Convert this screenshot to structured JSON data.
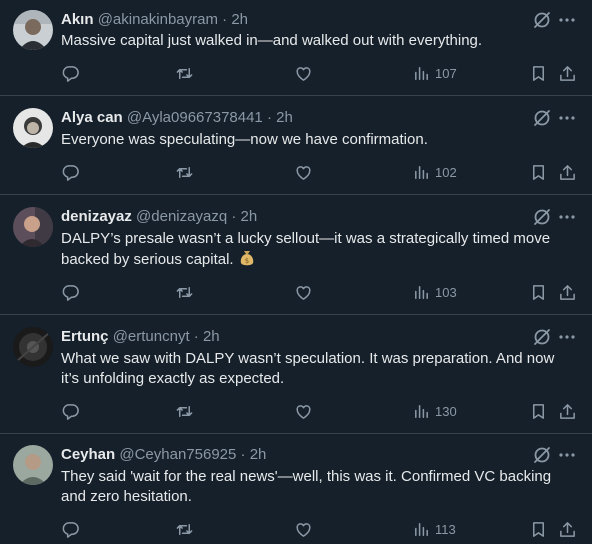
{
  "tweets": [
    {
      "name": "Akın",
      "handle": "@akinakinbayram",
      "time": "2h",
      "text": "Massive capital just walked in—and walked out with everything.",
      "views": "107",
      "avatar_color": "#cfd4d8"
    },
    {
      "name": "Alya can",
      "handle": "@Ayla09667378441",
      "time": "2h",
      "text": "Everyone was speculating—now we have confirmation.",
      "views": "102",
      "avatar_color": "#dadada"
    },
    {
      "name": "denizayaz",
      "handle": "@denizayazq",
      "time": "2h",
      "text": "DALPY’s presale wasn’t a lucky sellout—it was a strategically timed move backed by serious capital.",
      "emoji": "money-bag",
      "views": "103",
      "avatar_color": "#6a5a66"
    },
    {
      "name": "Ertunç",
      "handle": "@ertuncnyt",
      "time": "2h",
      "text": "What we saw with DALPY wasn’t speculation. It was preparation. And now it’s unfolding exactly as expected.",
      "views": "130",
      "avatar_color": "#262626"
    },
    {
      "name": "Ceyhan",
      "handle": "@Ceyhan756925",
      "time": "2h",
      "text": "They said 'wait for the real news'—well, this was it. Confirmed VC backing and zero hesitation.",
      "views": "113",
      "avatar_color": "#8a9a92"
    }
  ],
  "separator": "·",
  "icons": [
    "reply-icon",
    "retweet-icon",
    "like-icon",
    "views-icon",
    "bookmark-icon",
    "share-icon",
    "grok-icon",
    "more-icon"
  ],
  "colors": {
    "background": "#15202b",
    "text": "#e7e9ea",
    "muted": "#8b98a5",
    "divider": "#38444d"
  }
}
